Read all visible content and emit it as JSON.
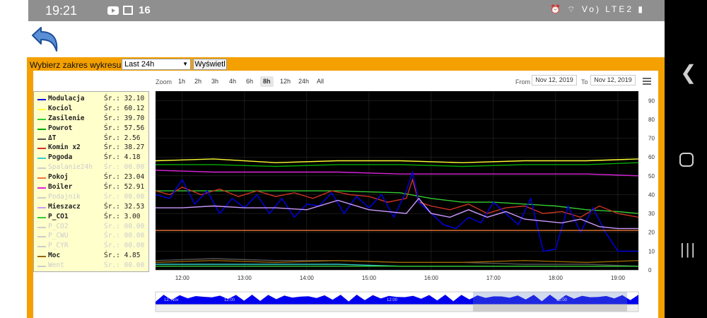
{
  "status": {
    "time": "19:21",
    "notif": "16",
    "right": "Vo) LTE2"
  },
  "controls": {
    "range_label": "Wybierz zakres wykresu:",
    "range_value": "Last 24h",
    "show_label": "Wyświetl",
    "zoom_label": "Zoom",
    "zoom_buttons": [
      "1h",
      "2h",
      "3h",
      "4h",
      "6h",
      "8h",
      "12h",
      "24h",
      "All"
    ],
    "zoom_selected": "8h",
    "from_label": "From",
    "from_value": "Nov 12, 2019",
    "to_label": "To",
    "to_value": "Nov 12, 2019"
  },
  "legend": [
    {
      "name": "Modulacja",
      "avg": "Śr.: 32.10",
      "color": "#0000ee",
      "visible": true
    },
    {
      "name": "Kociol",
      "avg": "Śr.: 60.12",
      "color": "#ffff33",
      "visible": true
    },
    {
      "name": "Zasilenie",
      "avg": "Śr.: 39.70",
      "color": "#33cc33",
      "visible": true
    },
    {
      "name": "Powrot",
      "avg": "Śr.: 57.56",
      "color": "#00aa00",
      "visible": true
    },
    {
      "name": "ΔT",
      "avg": "Śr.: 2.56",
      "color": "#555555",
      "visible": true
    },
    {
      "name": "Komin x2",
      "avg": "Śr.: 38.27",
      "color": "#cc3322",
      "visible": true
    },
    {
      "name": "Pogoda",
      "avg": "Śr.: 4.18",
      "color": "#33cccc",
      "visible": true
    },
    {
      "name": "Spalanie24h",
      "avg": "Śr.: 00.00",
      "color": "#cccccc",
      "visible": false
    },
    {
      "name": "Pokoj",
      "avg": "Śr.: 23.04",
      "color": "#ee7733",
      "visible": true
    },
    {
      "name": "Boiler",
      "avg": "Śr.: 52.91",
      "color": "#dd22dd",
      "visible": true
    },
    {
      "name": "Podajnik",
      "avg": "Śr.: 00.00",
      "color": "#cccccc",
      "visible": false
    },
    {
      "name": "Mieszacz",
      "avg": "Śr.: 32.53",
      "color": "#cc99ff",
      "visible": true
    },
    {
      "name": "P_CO1",
      "avg": "Śr.: 3.00",
      "color": "#33cc33",
      "visible": true
    },
    {
      "name": "P_CO2",
      "avg": "Śr.: 00.00",
      "color": "#cccccc",
      "visible": false
    },
    {
      "name": "P_CWU",
      "avg": "Śr.: 00.00",
      "color": "#cccccc",
      "visible": false
    },
    {
      "name": "P_CYR",
      "avg": "Śr.: 00.00",
      "color": "#cccccc",
      "visible": false
    },
    {
      "name": "Moc",
      "avg": "Śr.: 4.85",
      "color": "#996600",
      "visible": true
    },
    {
      "name": "Went",
      "avg": "Śr.: 00.00",
      "color": "#cccccc",
      "visible": false
    }
  ],
  "navigator": {
    "labels": [
      "12. Nov",
      "12:00",
      "12:00",
      "12:00"
    ]
  },
  "chart_data": {
    "type": "line",
    "x_ticks": [
      "12:00",
      "13:00",
      "14:00",
      "15:00",
      "16:00",
      "17:00",
      "18:00",
      "19:00"
    ],
    "x_range": [
      11.57,
      19.33
    ],
    "y_ticks": [
      0,
      10,
      20,
      30,
      40,
      50,
      60,
      70,
      80,
      90
    ],
    "ylim": [
      0,
      95
    ],
    "background": "#000000",
    "series": [
      {
        "name": "Kociol",
        "color": "#ffff33",
        "x": [
          11.57,
          12.5,
          13.5,
          14.5,
          15.5,
          16.5,
          17.5,
          18.5,
          19.33
        ],
        "y": [
          58,
          59,
          57,
          58,
          58,
          57,
          58,
          58,
          59
        ]
      },
      {
        "name": "Powrot",
        "color": "#00aa00",
        "x": [
          11.57,
          12.5,
          13.5,
          14.5,
          15.5,
          16.5,
          17.5,
          18.5,
          19.33
        ],
        "y": [
          56,
          56,
          55,
          56,
          56,
          55,
          56,
          56,
          57
        ]
      },
      {
        "name": "Boiler",
        "color": "#dd22dd",
        "x": [
          11.57,
          12.5,
          13.5,
          14.5,
          15.5,
          16.5,
          17.5,
          18.5,
          19.33
        ],
        "y": [
          53,
          52,
          52,
          52,
          51,
          51,
          51,
          51,
          50
        ]
      },
      {
        "name": "Zasilenie",
        "color": "#33cc33",
        "x": [
          11.57,
          12.5,
          13.5,
          14.5,
          15.5,
          16,
          16.5,
          17,
          17.5,
          18,
          18.5,
          19,
          19.33
        ],
        "y": [
          42,
          42,
          42,
          42,
          41,
          38,
          36,
          36,
          35,
          34,
          32,
          31,
          30
        ]
      },
      {
        "name": "Komin x2",
        "color": "#cc3322",
        "x": [
          11.57,
          11.8,
          12.0,
          12.3,
          12.6,
          12.9,
          13.2,
          13.5,
          13.8,
          14.1,
          14.4,
          14.7,
          15.0,
          15.3,
          15.6,
          15.7,
          15.8,
          16.0,
          16.3,
          16.6,
          16.9,
          17.2,
          17.5,
          17.8,
          18.1,
          18.4,
          18.7,
          19.0,
          19.33
        ],
        "y": [
          42,
          40,
          44,
          40,
          43,
          39,
          42,
          39,
          41,
          38,
          42,
          40,
          39,
          36,
          38,
          48,
          36,
          34,
          32,
          35,
          30,
          33,
          34,
          30,
          31,
          28,
          34,
          30,
          28
        ]
      },
      {
        "name": "Modulacja",
        "color": "#0000ee",
        "x": [
          11.57,
          11.8,
          12.0,
          12.2,
          12.4,
          12.6,
          12.8,
          13.0,
          13.2,
          13.4,
          13.6,
          13.8,
          14.0,
          14.2,
          14.4,
          14.6,
          14.8,
          15.0,
          15.2,
          15.4,
          15.6,
          15.7,
          15.8,
          16.0,
          16.2,
          16.4,
          16.6,
          16.8,
          17.0,
          17.2,
          17.4,
          17.6,
          17.8,
          18.0,
          18.2,
          18.4,
          18.6,
          18.8,
          19.0,
          19.33
        ],
        "y": [
          40,
          38,
          48,
          35,
          42,
          30,
          38,
          33,
          40,
          30,
          38,
          28,
          35,
          34,
          41,
          30,
          39,
          33,
          40,
          28,
          42,
          52,
          36,
          30,
          24,
          22,
          28,
          25,
          36,
          30,
          24,
          38,
          10,
          11,
          34,
          20,
          33,
          20,
          10,
          10
        ]
      },
      {
        "name": "Mieszacz",
        "color": "#cc99ff",
        "x": [
          11.57,
          12.0,
          12.5,
          13.0,
          13.5,
          14.0,
          14.5,
          15.0,
          15.3,
          15.6,
          15.8,
          16.0,
          16.3,
          16.6,
          16.9,
          17.2,
          17.5,
          17.8,
          18.1,
          18.4,
          18.7,
          19.0,
          19.33
        ],
        "y": [
          33,
          33,
          34,
          33,
          33,
          32,
          37,
          32,
          31,
          30,
          38,
          30,
          28,
          32,
          28,
          31,
          27,
          26,
          25,
          27,
          23,
          22,
          22
        ]
      },
      {
        "name": "Pokoj",
        "color": "#ee7733",
        "x": [
          11.57,
          19.33
        ],
        "y": [
          21,
          21
        ]
      },
      {
        "name": "ΔT",
        "color": "#555555",
        "x": [
          11.57,
          12.5,
          13.5,
          14.5,
          15.5,
          16.5,
          17.5,
          18.5,
          19.33
        ],
        "y": [
          5,
          6,
          5,
          5,
          4,
          4,
          3,
          3,
          2
        ]
      },
      {
        "name": "Moc",
        "color": "#996600",
        "x": [
          11.57,
          12.5,
          13.5,
          14.5,
          15.5,
          16.5,
          17.5,
          18.5,
          19.33
        ],
        "y": [
          4,
          5,
          4,
          5,
          4,
          4,
          5,
          4,
          5
        ]
      },
      {
        "name": "Pogoda",
        "color": "#33cccc",
        "x": [
          11.57,
          12.5,
          13.5,
          14.5,
          15.5,
          16.5,
          17.5,
          18.5,
          19.33
        ],
        "y": [
          3,
          3,
          3,
          3,
          2,
          2,
          2,
          2,
          2
        ]
      },
      {
        "name": "P_CO1",
        "color": "#33cc33",
        "x": [
          11.57,
          12.5,
          13.5,
          14.5,
          15.5,
          16.5,
          17.5,
          18.5,
          19.33
        ],
        "y": [
          2,
          2,
          2,
          2,
          2,
          2,
          2,
          2,
          2
        ]
      }
    ]
  }
}
